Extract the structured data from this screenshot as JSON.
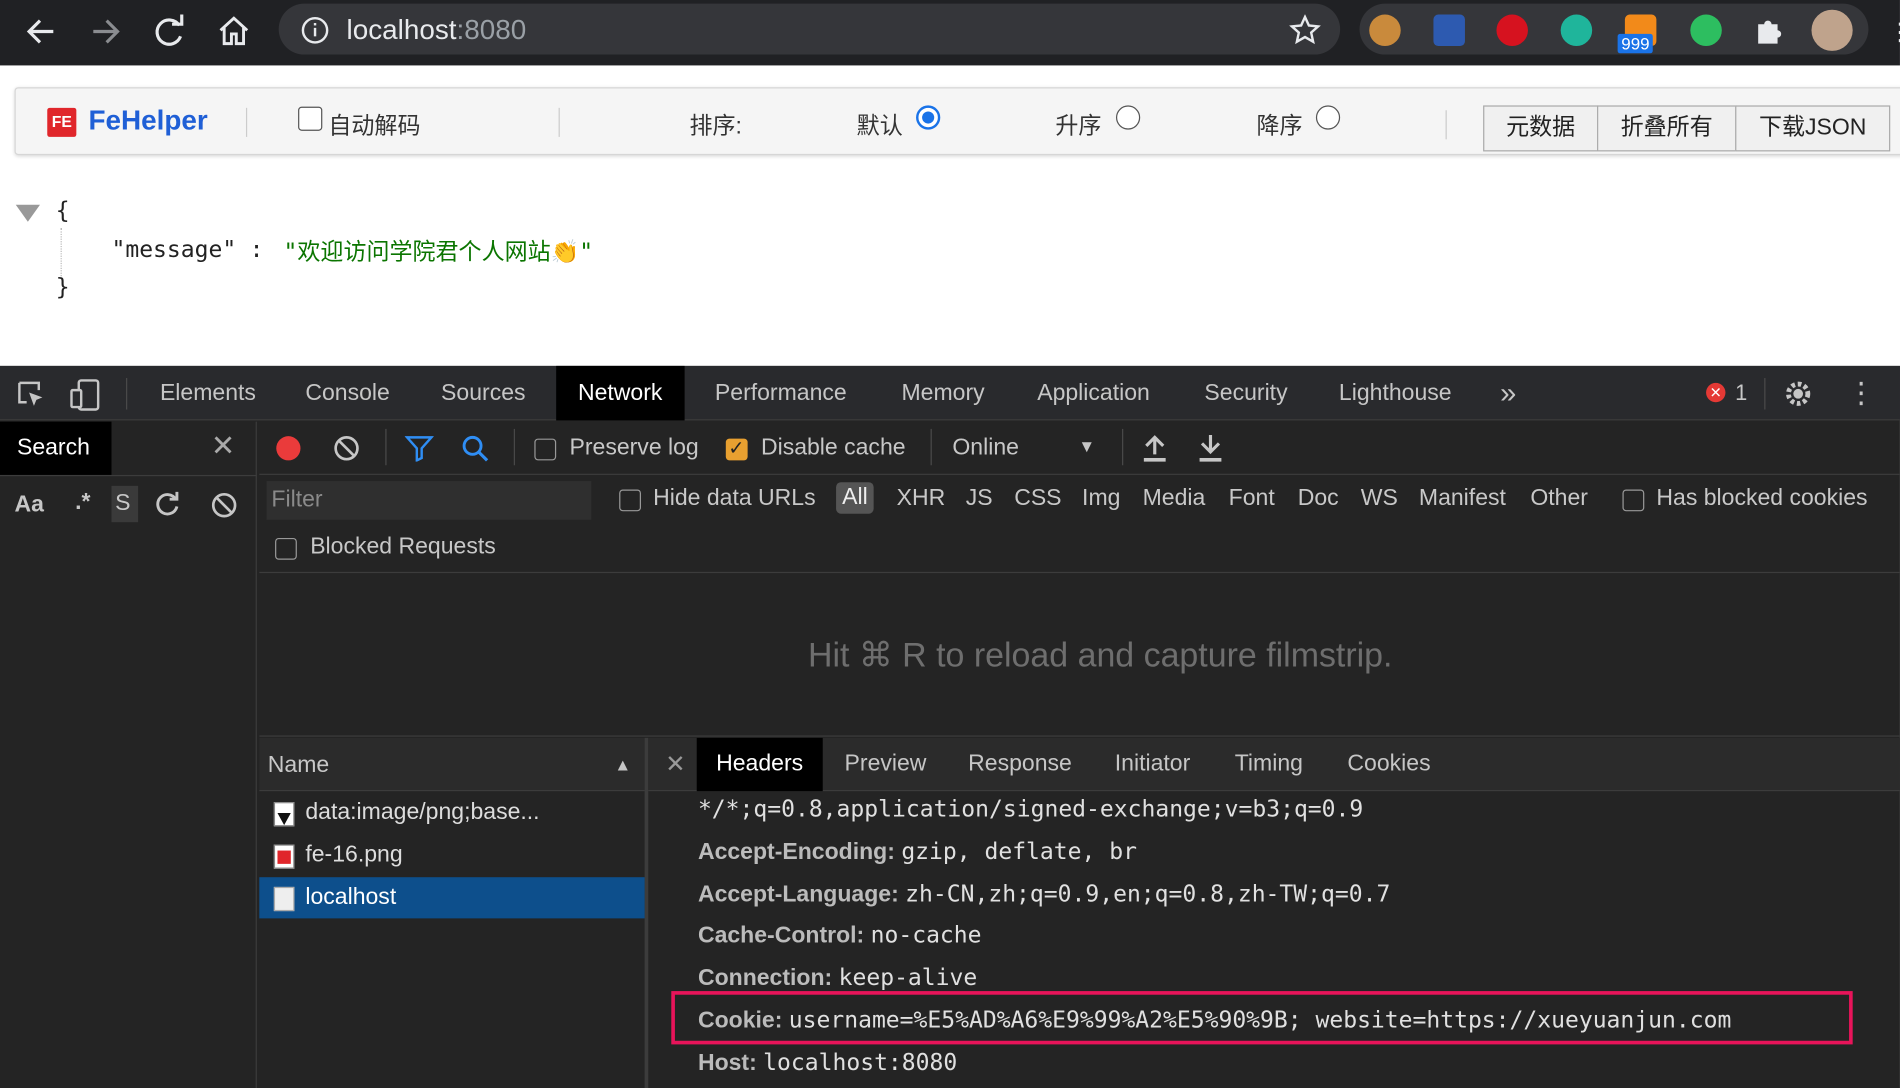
{
  "browser": {
    "address": "localhost",
    "port": ":8080",
    "ext_badge": "999"
  },
  "fehelper": {
    "logo": "FeHelper",
    "auto_decode": "自动解码",
    "sort_label": "排序:",
    "sort_default": "默认",
    "sort_asc": "升序",
    "sort_desc": "降序",
    "btn_raw": "元数据",
    "btn_fold": "折叠所有",
    "btn_download": "下载JSON"
  },
  "json_view": {
    "open_brace": "{",
    "key": "\"message\"",
    "colon": ":",
    "value": "\"欢迎访问学院君个人网站👏\"",
    "close_brace": "}"
  },
  "devtools": {
    "tabs": [
      "Elements",
      "Console",
      "Sources",
      "Network",
      "Performance",
      "Memory",
      "Application",
      "Security",
      "Lighthouse"
    ],
    "more": "»",
    "error_count": "1",
    "search_tab": "Search",
    "search_aa": "Aa",
    "search_regex": ".*",
    "search_sc": "S",
    "preserve_log": "Preserve log",
    "disable_cache": "Disable cache",
    "throttle": "Online",
    "filter_placeholder": "Filter",
    "hide_data_urls": "Hide data URLs",
    "types": [
      "All",
      "XHR",
      "JS",
      "CSS",
      "Img",
      "Media",
      "Font",
      "Doc",
      "WS",
      "Manifest",
      "Other"
    ],
    "has_blocked_cookies": "Has blocked cookies",
    "blocked_requests": "Blocked Requests",
    "filmstrip_hint": "Hit ⌘ R to reload and capture filmstrip.",
    "name_header": "Name",
    "requests": [
      "data:image/png;base...",
      "fe-16.png",
      "localhost"
    ],
    "detail_tabs": [
      "Headers",
      "Preview",
      "Response",
      "Initiator",
      "Timing",
      "Cookies"
    ],
    "headers": [
      {
        "name": "",
        "value": "*/*;q=0.8,application/signed-exchange;v=b3;q=0.9"
      },
      {
        "name": "Accept-Encoding:",
        "value": "gzip, deflate, br"
      },
      {
        "name": "Accept-Language:",
        "value": "zh-CN,zh;q=0.9,en;q=0.8,zh-TW;q=0.7"
      },
      {
        "name": "Cache-Control:",
        "value": "no-cache"
      },
      {
        "name": "Connection:",
        "value": "keep-alive"
      },
      {
        "name": "Cookie:",
        "value": "username=%E5%AD%A6%E9%99%A2%E5%90%9B; website=https://xueyuanjun.com"
      },
      {
        "name": "Host:",
        "value": "localhost:8080"
      }
    ]
  },
  "colors": {
    "highlight_box": "#e8145a",
    "selected_row": "#0d4f8c",
    "record_red": "#ea3b3b",
    "json_string": "#0b7500"
  }
}
